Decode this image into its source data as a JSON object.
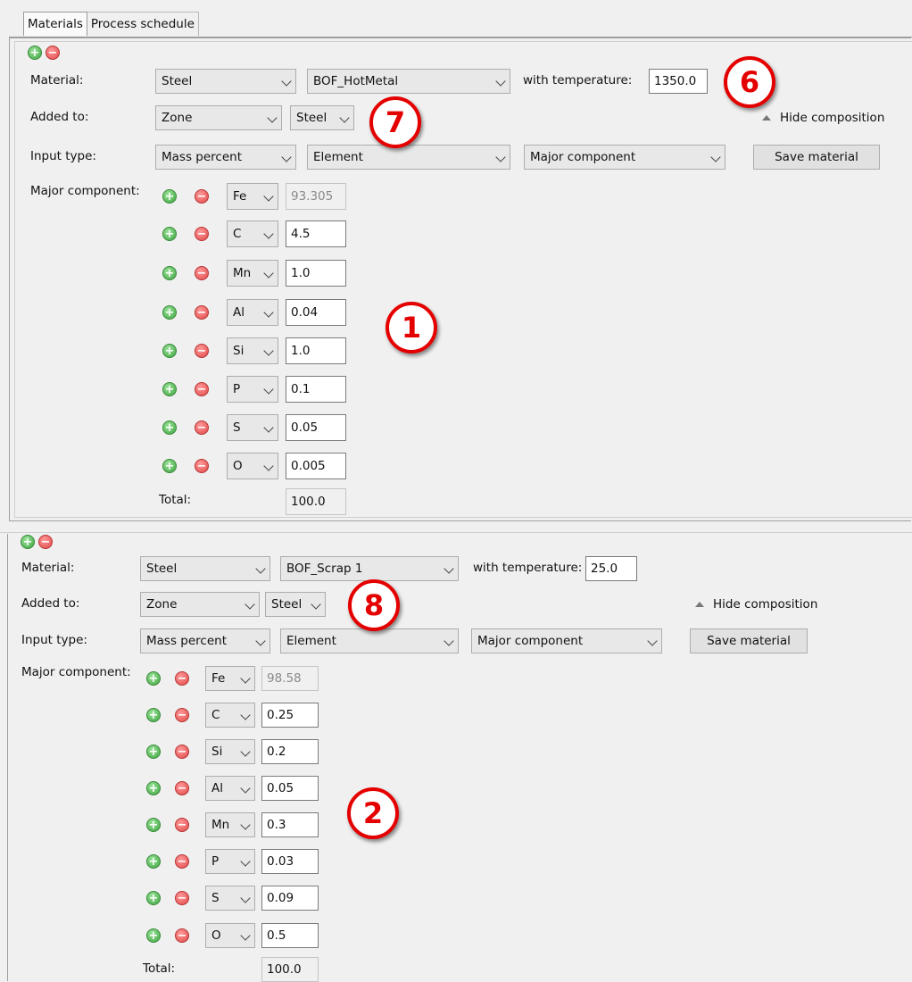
{
  "tabs": [
    "Materials",
    "Process schedule"
  ],
  "labels": {
    "material": "Material:",
    "added_to": "Added to:",
    "input_type": "Input type:",
    "major_component": "Major component:",
    "with_temperature": "with temperature:",
    "hide_composition": "Hide composition",
    "save_material": "Save material",
    "total": "Total:"
  },
  "materials": [
    {
      "category": "Steel",
      "name": "BOF_HotMetal",
      "temperature": "1350.0",
      "added_to_zone": "Zone",
      "added_to_target": "Steel",
      "input_type": "Mass percent",
      "element_type": "Element",
      "component_type": "Major component",
      "components": [
        {
          "element": "Fe",
          "value": "93.305"
        },
        {
          "element": "C",
          "value": "4.5"
        },
        {
          "element": "Mn",
          "value": "1.0"
        },
        {
          "element": "Al",
          "value": "0.04"
        },
        {
          "element": "Si",
          "value": "1.0"
        },
        {
          "element": "P",
          "value": "0.1"
        },
        {
          "element": "S",
          "value": "0.05"
        },
        {
          "element": "O",
          "value": "0.005"
        }
      ],
      "total": "100.0"
    },
    {
      "category": "Steel",
      "name": "BOF_Scrap 1",
      "temperature": "25.0",
      "added_to_zone": "Zone",
      "added_to_target": "Steel",
      "input_type": "Mass percent",
      "element_type": "Element",
      "component_type": "Major component",
      "components": [
        {
          "element": "Fe",
          "value": "98.58"
        },
        {
          "element": "C",
          "value": "0.25"
        },
        {
          "element": "Si",
          "value": "0.2"
        },
        {
          "element": "Al",
          "value": "0.05"
        },
        {
          "element": "Mn",
          "value": "0.3"
        },
        {
          "element": "P",
          "value": "0.03"
        },
        {
          "element": "S",
          "value": "0.09"
        },
        {
          "element": "O",
          "value": "0.5"
        }
      ],
      "total": "100.0"
    }
  ],
  "callouts": [
    "6",
    "7",
    "1",
    "8",
    "2"
  ],
  "colors": {
    "callout": "#e50000",
    "add": "#3fa43f",
    "remove": "#e04848"
  },
  "icons": {
    "add": "plus-circle-icon",
    "remove": "minus-circle-icon",
    "collapse": "triangle-up-icon",
    "dropdown": "chevron-down-icon"
  }
}
